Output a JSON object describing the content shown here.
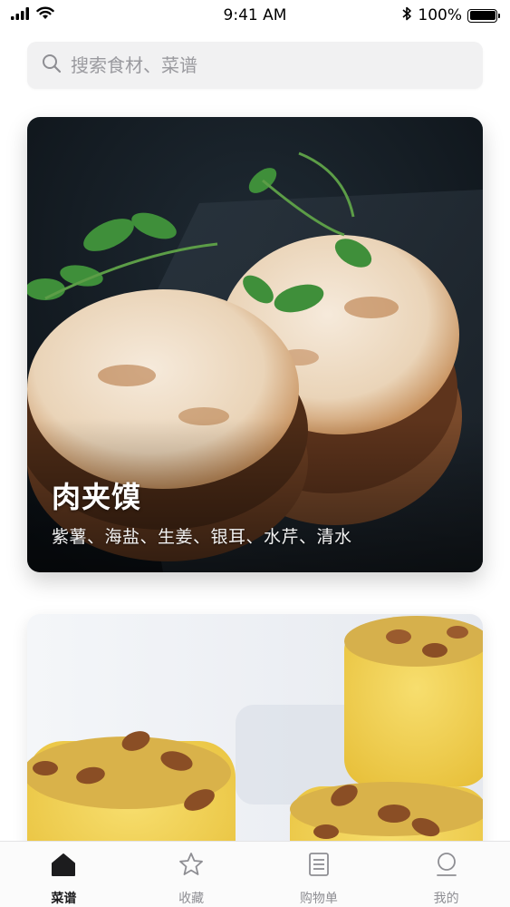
{
  "status_bar": {
    "time": "9:41 AM",
    "battery": "100%",
    "battery_level": 1.0
  },
  "search": {
    "placeholder": "搜索食材、菜谱",
    "icon": "search-icon"
  },
  "recipes": [
    {
      "title": "肉夹馍",
      "ingredients": "紫薯、海盐、生姜、银耳、水芹、清水",
      "image": "rou-jia-mo-photo"
    },
    {
      "title": "",
      "ingredients": "",
      "image": "sponge-cake-photo"
    }
  ],
  "tab_bar": {
    "items": [
      {
        "label": "菜谱",
        "icon": "home-icon",
        "active": true
      },
      {
        "label": "收藏",
        "icon": "star-icon",
        "active": false
      },
      {
        "label": "购物单",
        "icon": "list-icon",
        "active": false
      },
      {
        "label": "我的",
        "icon": "profile-icon",
        "active": false
      }
    ]
  },
  "colors": {
    "active_tab": "#1c1c1e",
    "inactive_tab": "#8e8e93",
    "search_bg": "#f1f1f2"
  }
}
